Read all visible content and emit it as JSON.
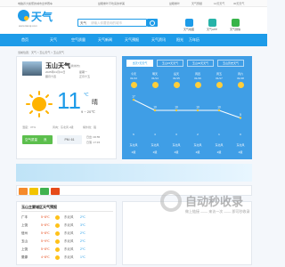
{
  "topbar": {
    "left": "电脑养大蚁聚的城市出学赛车",
    "mid": "益眼重叶不吃来的学美",
    "r1": "益眼重叶",
    "r2": "天气预报",
    "r3": "14天天气",
    "r4": "30天天气"
  },
  "header": {
    "logo_text": "天气",
    "logo_url": "www.tianqi.com",
    "search_city": "天气",
    "search_placeholder": "请输入你要查询的城市",
    "icons": [
      {
        "label": "天气地图",
        "color": "#1d9be8"
      },
      {
        "label": "天气APP",
        "color": "#27b3a8"
      },
      {
        "label": "天气微信",
        "color": "#38b449"
      }
    ]
  },
  "nav": [
    "首页",
    "天气",
    "空气质量",
    "天气新闻",
    "天气预报",
    "天气资讯",
    "阳光",
    "万年历"
  ],
  "breadcrumb": "当前位置：天气 > 玉山天气 > 玉山天气",
  "current": {
    "city": "玉山天气",
    "tag": "[切换城市]",
    "date": "2025年01月13日",
    "weekday": "星期一",
    "lunar": "腊月十四",
    "extra": "正月十五",
    "temp": "11",
    "unit": "℃",
    "condition": "晴",
    "range": "9 ~ 20℃",
    "humidity": "湿度：37%",
    "wind": "风向：东北风 2级",
    "uv": "紫外线：强",
    "aqi_label": "空气质量",
    "aqi_value": "良",
    "pm": "PM: 61",
    "sunrise": "日出: 06:55",
    "sunset": "日落: 17:15"
  },
  "forecast": {
    "tabs": [
      "当天7天天气",
      "玉山15天天气",
      "玉山40天天气",
      "玉山历史天气"
    ],
    "days": [
      {
        "day": "今天",
        "date": "01/13",
        "high": "17",
        "low": "6",
        "wind": "东北风",
        "level": "2级"
      },
      {
        "day": "明天",
        "date": "01/14",
        "high": "10",
        "low": "4",
        "wind": "东北风",
        "level": "2级"
      },
      {
        "day": "后天",
        "date": "01/15",
        "high": "10",
        "low": "3",
        "wind": "东北风",
        "level": "2级"
      },
      {
        "day": "周四",
        "date": "01/16",
        "high": "10",
        "low": "2",
        "wind": "东北风",
        "level": "2级"
      },
      {
        "day": "周五",
        "date": "01/17",
        "high": "10",
        "low": "1",
        "wind": "东北风",
        "level": "2级"
      },
      {
        "day": "周六",
        "date": "01/18",
        "high": "5",
        "low": "0",
        "wind": "东北风",
        "level": "2级"
      }
    ]
  },
  "table": {
    "title": "玉山主要城区天气预报",
    "rows": [
      {
        "city": "广丰",
        "high": "5~8℃",
        "wind": "东北风",
        "low": "2℃"
      },
      {
        "city": "上饶",
        "high": "5~8℃",
        "wind": "东北风",
        "low": "3℃"
      },
      {
        "city": "信州",
        "high": "5~8℃",
        "wind": "东北风",
        "low": "2℃"
      },
      {
        "city": "玉山",
        "high": "5~9℃",
        "wind": "东北风",
        "low": "2℃"
      },
      {
        "city": "上饶",
        "high": "5~8℃",
        "wind": "东北风",
        "low": "2℃"
      },
      {
        "city": "婺源",
        "high": "4~8℃",
        "wind": "东北风",
        "low": "1℃"
      }
    ]
  },
  "watermark": {
    "big": "自动秒收录",
    "small": "做上链接 —— 来访一次 —— 即可秒收录"
  }
}
